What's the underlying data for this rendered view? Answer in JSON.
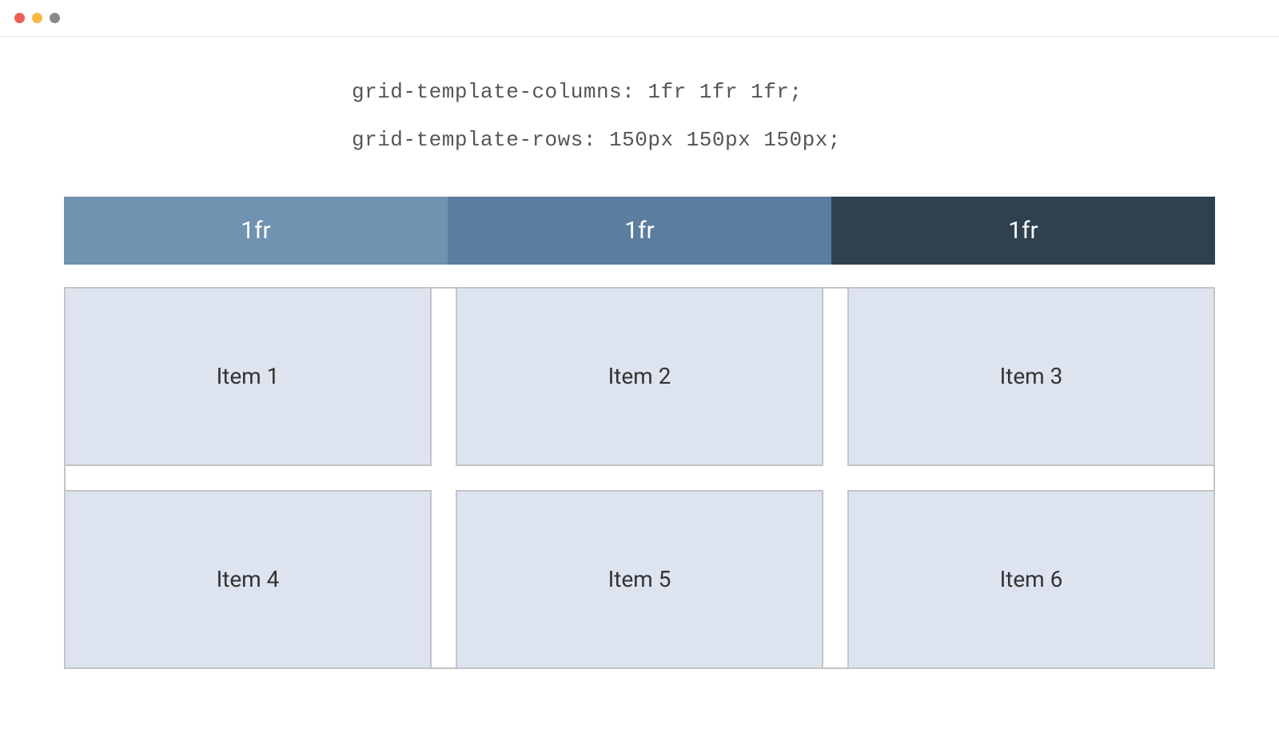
{
  "code": {
    "line1": "grid-template-columns: 1fr 1fr 1fr;",
    "line2": "grid-template-rows: 150px 150px 150px;"
  },
  "header": {
    "col1": "1fr",
    "col2": "1fr",
    "col3": "1fr"
  },
  "items": {
    "i1": "Item 1",
    "i2": "Item 2",
    "i3": "Item 3",
    "i4": "Item 4",
    "i5": "Item 5",
    "i6": "Item 6"
  },
  "colors": {
    "header_col1": "#6f93b0",
    "header_col2": "#5b7e9e",
    "header_col3": "#2f414f",
    "item_bg": "#dde4f0",
    "border": "#c4c4c4"
  }
}
